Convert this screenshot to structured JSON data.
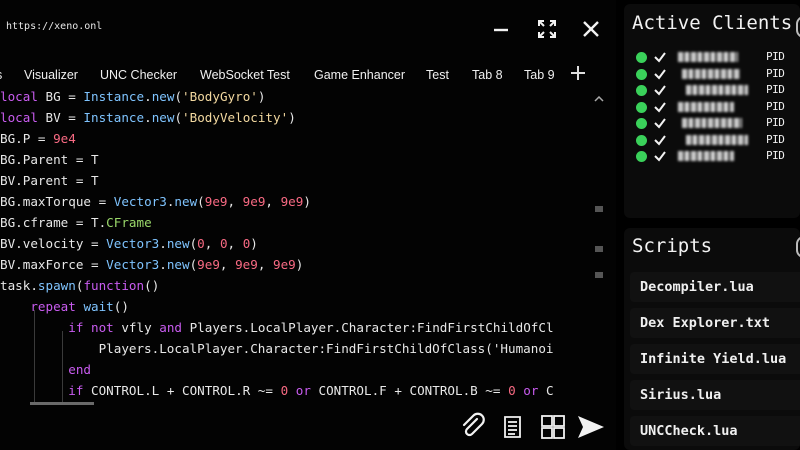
{
  "window": {
    "url": "https://xeno.onl"
  },
  "tabs": [
    {
      "label": "s"
    },
    {
      "label": "Visualizer"
    },
    {
      "label": "UNC Checker"
    },
    {
      "label": "WebSocket Test"
    },
    {
      "label": "Game Enhancer"
    },
    {
      "label": "Test"
    },
    {
      "label": "Tab 8"
    },
    {
      "label": "Tab 9"
    }
  ],
  "editor": {
    "lines": [
      [
        [
          "k",
          "local"
        ],
        [
          "t",
          " BG = "
        ],
        [
          "n",
          "Instance"
        ],
        [
          "t",
          "."
        ],
        [
          "n",
          "new"
        ],
        [
          "t",
          "("
        ],
        [
          "s",
          "'BodyGyro'"
        ],
        [
          "t",
          ")"
        ]
      ],
      [
        [
          "k",
          "local"
        ],
        [
          "t",
          " BV = "
        ],
        [
          "n",
          "Instance"
        ],
        [
          "t",
          "."
        ],
        [
          "n",
          "new"
        ],
        [
          "t",
          "("
        ],
        [
          "s",
          "'BodyVelocity'"
        ],
        [
          "t",
          ")"
        ]
      ],
      [
        [
          "t",
          "BG.P = "
        ],
        [
          "num",
          "9e4"
        ]
      ],
      [
        [
          "t",
          "BG.Parent = T"
        ]
      ],
      [
        [
          "t",
          "BV.Parent = T"
        ]
      ],
      [
        [
          "t",
          "BG.maxTorque = "
        ],
        [
          "n",
          "Vector3"
        ],
        [
          "t",
          "."
        ],
        [
          "n",
          "new"
        ],
        [
          "t",
          "("
        ],
        [
          "num",
          "9e9"
        ],
        [
          "t",
          ", "
        ],
        [
          "num",
          "9e9"
        ],
        [
          "t",
          ", "
        ],
        [
          "num",
          "9e9"
        ],
        [
          "t",
          ")"
        ]
      ],
      [
        [
          "t",
          "BG.cframe = T."
        ],
        [
          "g",
          "CFrame"
        ]
      ],
      [
        [
          "t",
          "BV.velocity = "
        ],
        [
          "n",
          "Vector3"
        ],
        [
          "t",
          "."
        ],
        [
          "n",
          "new"
        ],
        [
          "t",
          "("
        ],
        [
          "num",
          "0"
        ],
        [
          "t",
          ", "
        ],
        [
          "num",
          "0"
        ],
        [
          "t",
          ", "
        ],
        [
          "num",
          "0"
        ],
        [
          "t",
          ")"
        ]
      ],
      [
        [
          "t",
          "BV.maxForce = "
        ],
        [
          "n",
          "Vector3"
        ],
        [
          "t",
          "."
        ],
        [
          "n",
          "new"
        ],
        [
          "t",
          "("
        ],
        [
          "num",
          "9e9"
        ],
        [
          "t",
          ", "
        ],
        [
          "num",
          "9e9"
        ],
        [
          "t",
          ", "
        ],
        [
          "num",
          "9e9"
        ],
        [
          "t",
          ")"
        ]
      ],
      [
        [
          "t",
          "task."
        ],
        [
          "n",
          "spawn"
        ],
        [
          "t",
          "("
        ],
        [
          "k",
          "function"
        ],
        [
          "t",
          "()"
        ]
      ],
      [
        [
          "t",
          "    "
        ],
        [
          "k",
          "repeat"
        ],
        [
          "t",
          " "
        ],
        [
          "n",
          "wait"
        ],
        [
          "t",
          "()"
        ]
      ],
      [
        [
          "t",
          "         "
        ],
        [
          "k",
          "if not"
        ],
        [
          "t",
          " vfly "
        ],
        [
          "k",
          "and"
        ],
        [
          "t",
          " Players.LocalPlayer.Character:FindFirstChildOfCl"
        ]
      ],
      [
        [
          "t",
          "             Players.LocalPlayer.Character:FindFirstChildOfClass('Humanoi"
        ]
      ],
      [
        [
          "t",
          "         "
        ],
        [
          "k",
          "end"
        ]
      ],
      [
        [
          "t",
          "         "
        ],
        [
          "k",
          "if"
        ],
        [
          "t",
          " CONTROL.L + CONTROL.R ~= "
        ],
        [
          "num",
          "0"
        ],
        [
          "t",
          " "
        ],
        [
          "k",
          "or"
        ],
        [
          "t",
          " CONTROL.F + CONTROL.B ~= "
        ],
        [
          "num",
          "0"
        ],
        [
          "t",
          " "
        ],
        [
          "k",
          "or"
        ],
        [
          "t",
          " C"
        ]
      ]
    ]
  },
  "clients": {
    "title": "Active Clients",
    "rows": [
      {
        "pid": "PID"
      },
      {
        "pid": "PID"
      },
      {
        "pid": "PID"
      },
      {
        "pid": "PID"
      },
      {
        "pid": "PID"
      },
      {
        "pid": "PID"
      },
      {
        "pid": "PID"
      }
    ]
  },
  "scripts": {
    "title": "Scripts",
    "items": [
      "Decompiler.lua",
      "Dex Explorer.txt",
      "Infinite Yield.lua",
      "Sirius.lua",
      "UNCCheck.lua"
    ]
  },
  "colors": {
    "keyword": "#c95cf0",
    "function": "#7fc4ff",
    "string": "#f3d9a0",
    "number": "#f86a83",
    "status": "#3ad15a"
  },
  "icons": [
    "minimize-icon",
    "maximize-icon",
    "close-icon",
    "plus-icon",
    "attach-icon",
    "document-icon",
    "grid-icon",
    "send-icon",
    "checkbox-icon"
  ]
}
